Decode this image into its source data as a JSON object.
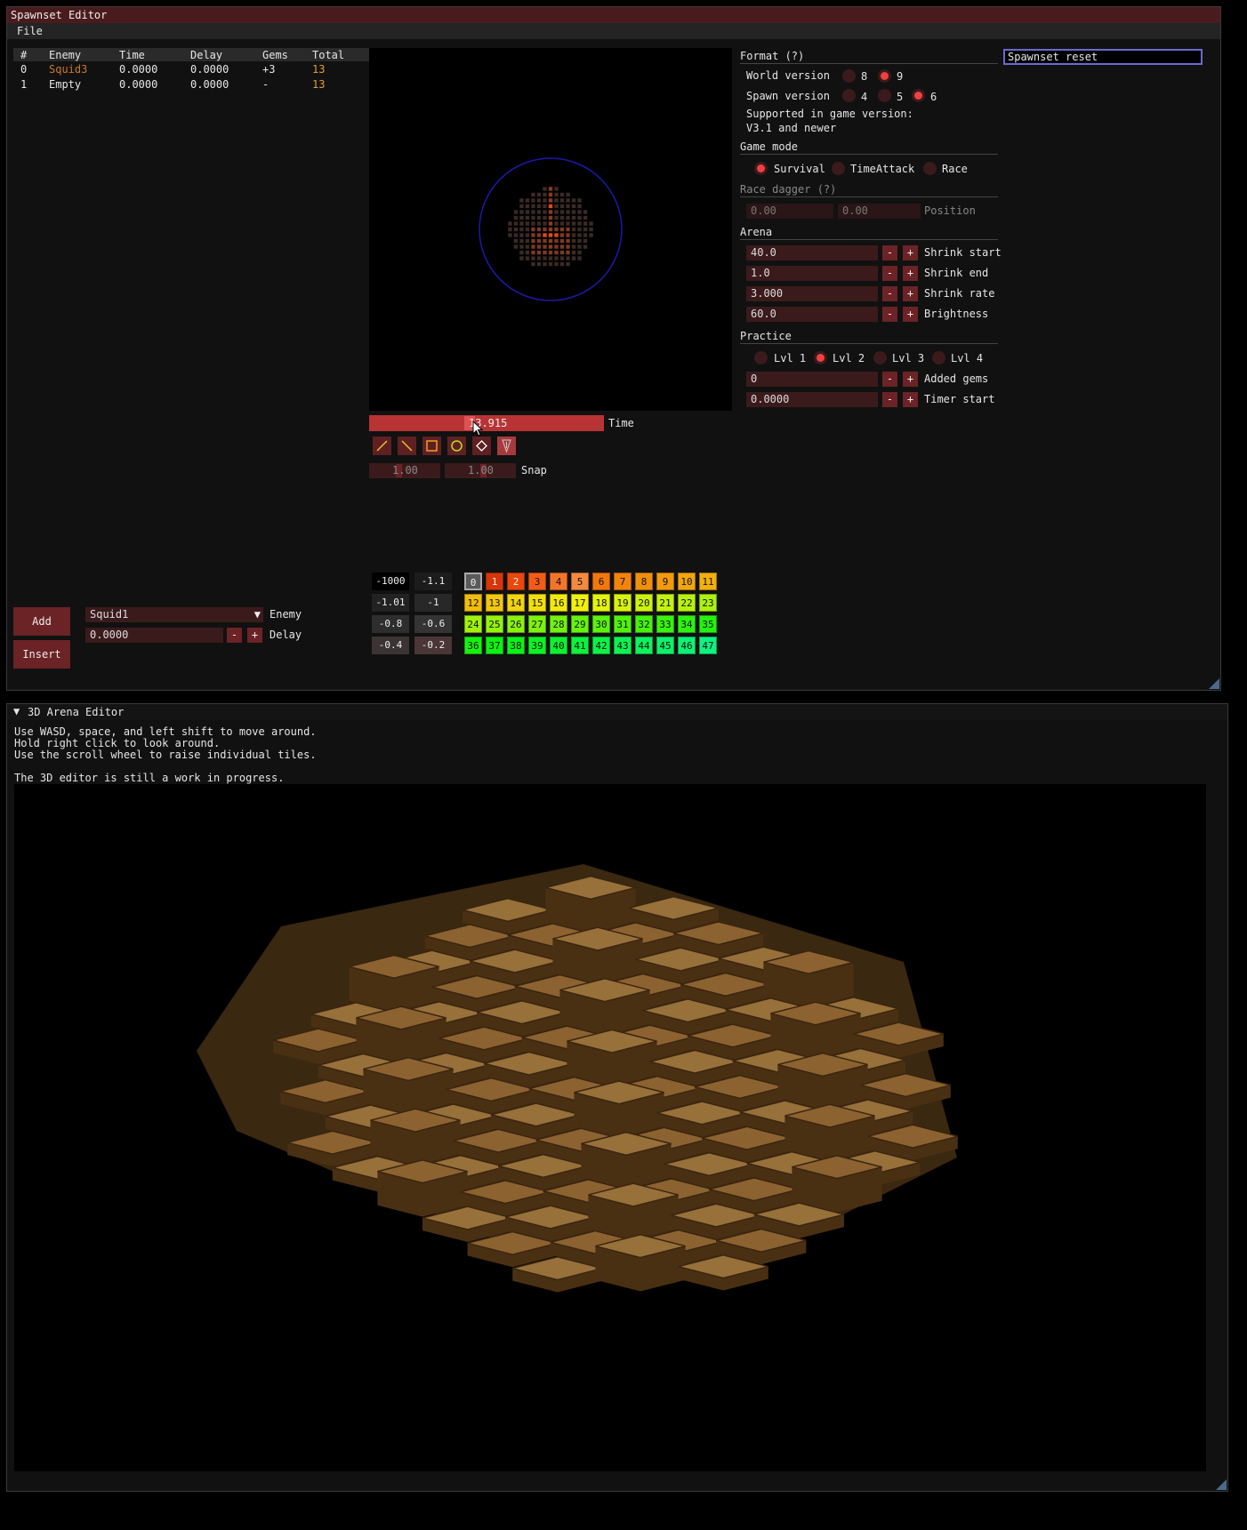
{
  "spawnset_window": {
    "title": "Spawnset Editor",
    "menu": [
      "File"
    ],
    "table": {
      "headers": [
        "#",
        "Enemy",
        "Time",
        "Delay",
        "Gems",
        "Total"
      ],
      "rows": [
        {
          "index": "0",
          "enemy": "Squid3",
          "time": "0.0000",
          "delay": "0.0000",
          "gems": "+3",
          "total": "13"
        },
        {
          "index": "1",
          "enemy": "Empty",
          "time": "0.0000",
          "delay": "0.0000",
          "gems": "-",
          "total": "13"
        }
      ]
    },
    "add_label": "Add",
    "insert_label": "Insert",
    "enemy_select": "Squid1",
    "enemy_label": "Enemy",
    "delay_value": "0.0000",
    "delay_label": "Delay",
    "minus": "-",
    "plus": "+"
  },
  "arena_view": {
    "time_value": "13.915",
    "time_label": "Time",
    "snap_x": "1.00",
    "snap_y": "1.00",
    "snap_label": "Snap",
    "tools": [
      "pencil-tool-icon",
      "line-tool-icon",
      "rectangle-tool-icon",
      "ellipse-tool-icon",
      "bucket-tool-icon",
      "dagger-tool-icon"
    ],
    "heights_special": [
      [
        "-1000",
        "-1.1"
      ],
      [
        "-1.01",
        "-1"
      ],
      [
        "-0.8",
        "-0.6"
      ],
      [
        "-0.4",
        "-0.2"
      ]
    ],
    "heights": [
      [
        "0",
        "1",
        "2",
        "3",
        "4",
        "5",
        "6",
        "7",
        "8",
        "9",
        "10",
        "11"
      ],
      [
        "12",
        "13",
        "14",
        "15",
        "16",
        "17",
        "18",
        "19",
        "20",
        "21",
        "22",
        "23"
      ],
      [
        "24",
        "25",
        "26",
        "27",
        "28",
        "29",
        "30",
        "31",
        "32",
        "33",
        "34",
        "35"
      ],
      [
        "36",
        "37",
        "38",
        "39",
        "40",
        "41",
        "42",
        "43",
        "44",
        "45",
        "46",
        "47"
      ]
    ]
  },
  "settings": {
    "format_label": "Format (?)",
    "world_version_label": "World version",
    "world_versions": [
      "8",
      "9"
    ],
    "spawn_version_label": "Spawn version",
    "spawn_versions": [
      "4",
      "5",
      "6"
    ],
    "supported_line1": "Supported in game version:",
    "supported_line2": "V3.1 and newer",
    "game_mode_label": "Game mode",
    "modes": [
      "Survival",
      "TimeAttack",
      "Race"
    ],
    "race_dagger_label": "Race dagger (?)",
    "race_x": "0.00",
    "race_z": "0.00",
    "position_label": "Position",
    "arena_label": "Arena",
    "arena_fields": [
      {
        "value": "40.0",
        "label": "Shrink start"
      },
      {
        "value": "1.0",
        "label": "Shrink end"
      },
      {
        "value": "3.000",
        "label": "Shrink rate"
      },
      {
        "value": "60.0",
        "label": "Brightness"
      }
    ],
    "practice_label": "Practice",
    "levels": [
      "Lvl 1",
      "Lvl 2",
      "Lvl 3",
      "Lvl 4"
    ],
    "practice_fields": [
      {
        "value": "0",
        "label": "Added gems"
      },
      {
        "value": "0.0000",
        "label": "Timer start"
      }
    ],
    "status_text": "Spawnset reset"
  },
  "editor3d": {
    "title": "3D Arena Editor",
    "collapse_icon": "triangle-down-icon",
    "help_line1": "Use WASD, space, and left shift to move around.",
    "help_line2": "Hold right click to look around.",
    "help_line3": "Use the scroll wheel to raise individual tiles.",
    "help_line4": "The 3D editor is still a work in progress."
  },
  "colors": {
    "accent_red": "#6b2326",
    "title_red": "#4a1b1d",
    "enemy_orange": "#e08a30",
    "radio_on": "#f04040"
  }
}
